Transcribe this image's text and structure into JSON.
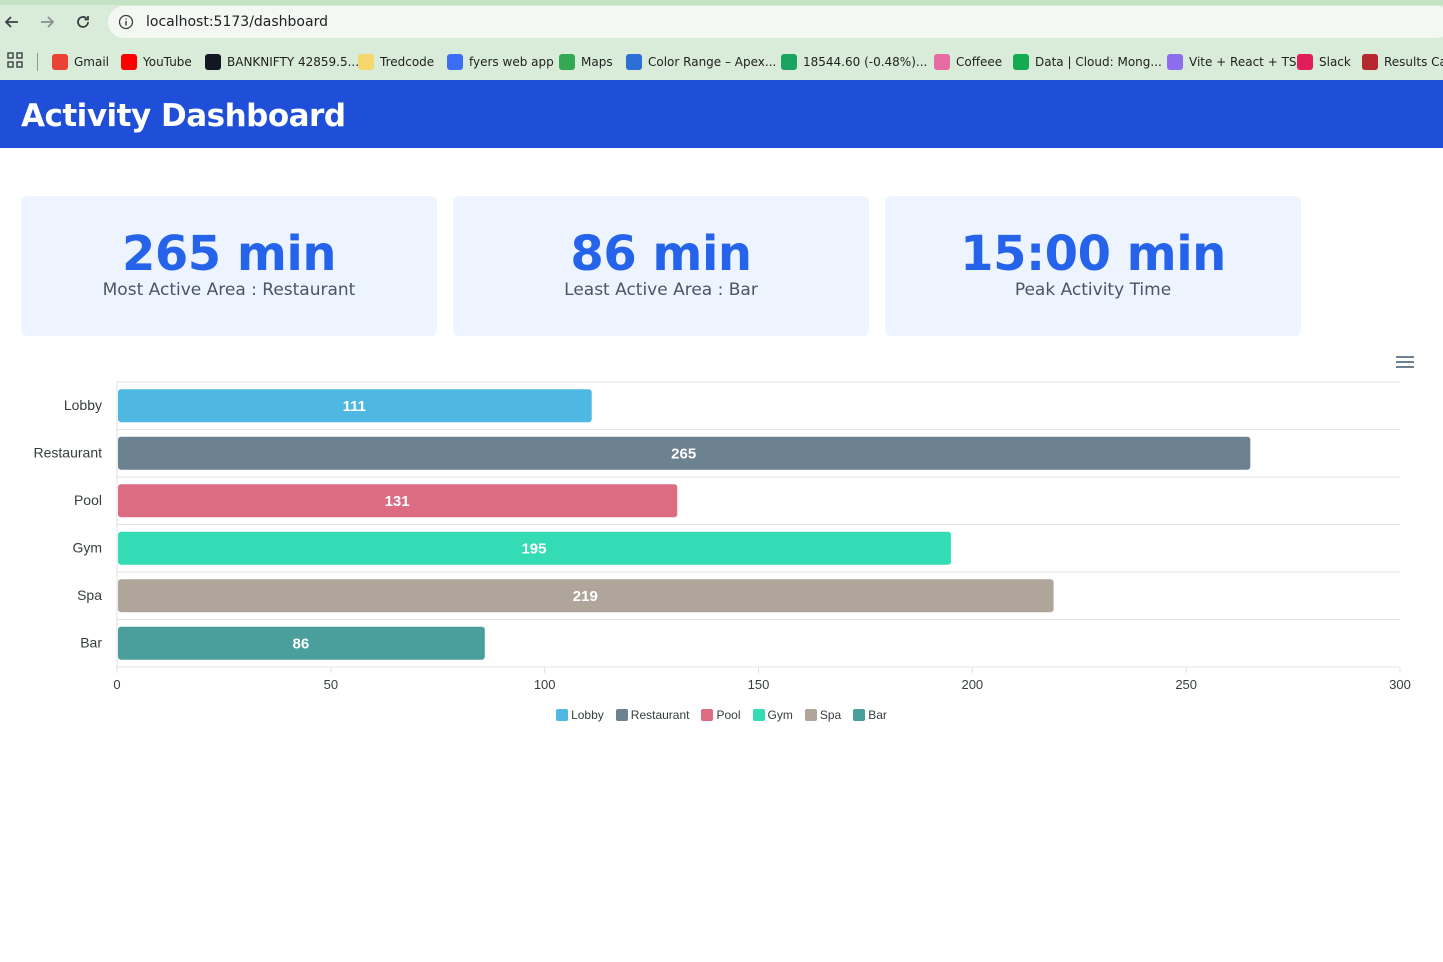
{
  "browser": {
    "url": "localhost:5173/dashboard",
    "bookmarks": [
      {
        "label": "Gmail",
        "icon": "gmail-icon",
        "color": "#ea4335"
      },
      {
        "label": "YouTube",
        "icon": "youtube-icon",
        "color": "#ff0000"
      },
      {
        "label": "BANKNIFTY 42859.5...",
        "icon": "tradingview-icon",
        "color": "#131722"
      },
      {
        "label": "Tredcode",
        "icon": "tredcode-icon",
        "color": "#f5d76e"
      },
      {
        "label": "fyers web app",
        "icon": "fyers-icon",
        "color": "#3b6ef5"
      },
      {
        "label": "Maps",
        "icon": "maps-icon",
        "color": "#34a853"
      },
      {
        "label": "Color Range – Apex...",
        "icon": "apex-icon",
        "color": "#2c6fd6"
      },
      {
        "label": "18544.60 (-0.48%)...",
        "icon": "ticker-icon",
        "color": "#1aa260"
      },
      {
        "label": "Coffeee",
        "icon": "coffee-icon",
        "color": "#e66ca3"
      },
      {
        "label": "Data | Cloud: Mong...",
        "icon": "mongodb-icon",
        "color": "#13aa52"
      },
      {
        "label": "Vite + React + TS",
        "icon": "vite-icon",
        "color": "#8e6cf0"
      },
      {
        "label": "Slack",
        "icon": "slack-icon",
        "color": "#e01e5a"
      },
      {
        "label": "Results Cal",
        "icon": "nse-icon",
        "color": "#b5282e"
      }
    ]
  },
  "header": {
    "title": "Activity Dashboard"
  },
  "cards": [
    {
      "value": "265 min",
      "label": "Most Active Area : Restaurant"
    },
    {
      "value": "86 min",
      "label": "Least Active Area : Bar"
    },
    {
      "value": "15:00 min",
      "label": "Peak Activity Time"
    }
  ],
  "chart_data": {
    "type": "bar",
    "orientation": "horizontal",
    "categories": [
      "Lobby",
      "Restaurant",
      "Pool",
      "Gym",
      "Spa",
      "Bar"
    ],
    "values": [
      111,
      265,
      131,
      195,
      219,
      86
    ],
    "colors": [
      "#4fb8e2",
      "#6d8290",
      "#dc6c82",
      "#33dcb5",
      "#b0a59b",
      "#4a9e9c"
    ],
    "xlim": [
      0,
      300
    ],
    "xticks": [
      0,
      50,
      100,
      150,
      200,
      250,
      300
    ],
    "data_labels": true,
    "grid": true,
    "legend": "bottom-center",
    "legend_entries": [
      "Lobby",
      "Restaurant",
      "Pool",
      "Gym",
      "Spa",
      "Bar"
    ]
  }
}
